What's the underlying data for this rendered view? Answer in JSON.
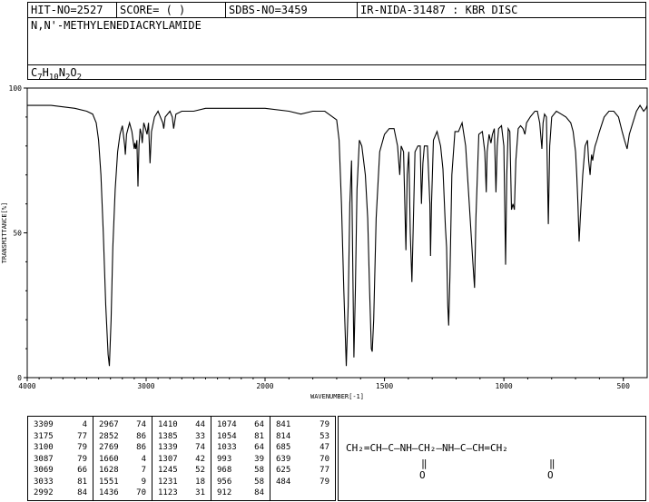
{
  "header": {
    "hit_no": "HIT-NO=2527",
    "score": "SCORE=  (   )",
    "sdbs_no": "SDBS-NO=3459",
    "ir_info": "IR-NIDA-31487 : KBR DISC",
    "compound_name": "N,N'-METHYLENEDIACRYLAMIDE",
    "formula": {
      "C": "7",
      "H": "10",
      "N": "2",
      "O": "2"
    }
  },
  "chart_data": {
    "type": "line",
    "xlabel": "WAVENUMBER[-1]",
    "ylabel": "TRANSMITTANCE[%]",
    "xlim": [
      4000,
      400
    ],
    "ylim": [
      0,
      100
    ],
    "x_ticks": [
      "4000",
      "3000",
      "2000",
      "1500",
      "1000",
      "500"
    ],
    "y_ticks": [
      "0",
      "50",
      "100"
    ],
    "grid": false,
    "series": [
      {
        "points": [
          [
            4000,
            94
          ],
          [
            3800,
            94
          ],
          [
            3600,
            93
          ],
          [
            3500,
            92
          ],
          [
            3450,
            91
          ],
          [
            3420,
            88
          ],
          [
            3400,
            82
          ],
          [
            3380,
            70
          ],
          [
            3360,
            50
          ],
          [
            3340,
            25
          ],
          [
            3320,
            8
          ],
          [
            3309,
            4
          ],
          [
            3295,
            20
          ],
          [
            3280,
            45
          ],
          [
            3260,
            65
          ],
          [
            3240,
            78
          ],
          [
            3220,
            84
          ],
          [
            3200,
            87
          ],
          [
            3180,
            80
          ],
          [
            3175,
            77
          ],
          [
            3165,
            84
          ],
          [
            3140,
            88
          ],
          [
            3120,
            85
          ],
          [
            3100,
            79
          ],
          [
            3095,
            81
          ],
          [
            3087,
            79
          ],
          [
            3078,
            82
          ],
          [
            3069,
            66
          ],
          [
            3060,
            80
          ],
          [
            3050,
            86
          ],
          [
            3040,
            84
          ],
          [
            3033,
            81
          ],
          [
            3020,
            88
          ],
          [
            3005,
            86
          ],
          [
            2992,
            84
          ],
          [
            2980,
            88
          ],
          [
            2967,
            74
          ],
          [
            2955,
            85
          ],
          [
            2930,
            90
          ],
          [
            2900,
            92
          ],
          [
            2880,
            90
          ],
          [
            2860,
            88
          ],
          [
            2852,
            86
          ],
          [
            2840,
            90
          ],
          [
            2800,
            92
          ],
          [
            2780,
            90
          ],
          [
            2769,
            86
          ],
          [
            2750,
            91
          ],
          [
            2700,
            92
          ],
          [
            2600,
            92
          ],
          [
            2500,
            93
          ],
          [
            2400,
            93
          ],
          [
            2300,
            93
          ],
          [
            2200,
            93
          ],
          [
            2100,
            93
          ],
          [
            2000,
            93
          ],
          [
            1900,
            92
          ],
          [
            1850,
            91
          ],
          [
            1800,
            92
          ],
          [
            1750,
            92
          ],
          [
            1700,
            89
          ],
          [
            1690,
            82
          ],
          [
            1680,
            60
          ],
          [
            1670,
            30
          ],
          [
            1660,
            4
          ],
          [
            1652,
            25
          ],
          [
            1645,
            60
          ],
          [
            1638,
            75
          ],
          [
            1633,
            40
          ],
          [
            1628,
            7
          ],
          [
            1622,
            30
          ],
          [
            1615,
            65
          ],
          [
            1605,
            82
          ],
          [
            1595,
            80
          ],
          [
            1580,
            70
          ],
          [
            1570,
            55
          ],
          [
            1562,
            30
          ],
          [
            1555,
            10
          ],
          [
            1551,
            9
          ],
          [
            1545,
            20
          ],
          [
            1535,
            55
          ],
          [
            1520,
            78
          ],
          [
            1500,
            84
          ],
          [
            1480,
            86
          ],
          [
            1460,
            86
          ],
          [
            1445,
            80
          ],
          [
            1436,
            70
          ],
          [
            1430,
            80
          ],
          [
            1420,
            78
          ],
          [
            1410,
            44
          ],
          [
            1405,
            70
          ],
          [
            1398,
            78
          ],
          [
            1392,
            50
          ],
          [
            1385,
            33
          ],
          [
            1380,
            50
          ],
          [
            1372,
            78
          ],
          [
            1360,
            80
          ],
          [
            1350,
            80
          ],
          [
            1345,
            60
          ],
          [
            1339,
            74
          ],
          [
            1333,
            80
          ],
          [
            1320,
            80
          ],
          [
            1310,
            60
          ],
          [
            1307,
            42
          ],
          [
            1303,
            60
          ],
          [
            1295,
            82
          ],
          [
            1280,
            85
          ],
          [
            1265,
            80
          ],
          [
            1255,
            72
          ],
          [
            1245,
            52
          ],
          [
            1240,
            45
          ],
          [
            1235,
            25
          ],
          [
            1231,
            18
          ],
          [
            1226,
            35
          ],
          [
            1218,
            70
          ],
          [
            1205,
            85
          ],
          [
            1190,
            85
          ],
          [
            1175,
            88
          ],
          [
            1160,
            80
          ],
          [
            1145,
            60
          ],
          [
            1130,
            40
          ],
          [
            1123,
            31
          ],
          [
            1117,
            55
          ],
          [
            1105,
            84
          ],
          [
            1090,
            85
          ],
          [
            1080,
            78
          ],
          [
            1074,
            64
          ],
          [
            1070,
            78
          ],
          [
            1062,
            84
          ],
          [
            1054,
            81
          ],
          [
            1048,
            84
          ],
          [
            1040,
            86
          ],
          [
            1033,
            64
          ],
          [
            1028,
            80
          ],
          [
            1022,
            86
          ],
          [
            1010,
            87
          ],
          [
            1000,
            80
          ],
          [
            993,
            39
          ],
          [
            988,
            70
          ],
          [
            982,
            86
          ],
          [
            975,
            85
          ],
          [
            968,
            58
          ],
          [
            962,
            60
          ],
          [
            956,
            58
          ],
          [
            950,
            75
          ],
          [
            940,
            86
          ],
          [
            930,
            87
          ],
          [
            920,
            86
          ],
          [
            912,
            84
          ],
          [
            905,
            88
          ],
          [
            890,
            90
          ],
          [
            870,
            92
          ],
          [
            860,
            92
          ],
          [
            850,
            88
          ],
          [
            841,
            79
          ],
          [
            836,
            88
          ],
          [
            830,
            91
          ],
          [
            822,
            90
          ],
          [
            814,
            53
          ],
          [
            808,
            80
          ],
          [
            800,
            90
          ],
          [
            780,
            92
          ],
          [
            760,
            91
          ],
          [
            740,
            90
          ],
          [
            720,
            88
          ],
          [
            710,
            85
          ],
          [
            700,
            78
          ],
          [
            695,
            70
          ],
          [
            690,
            60
          ],
          [
            685,
            47
          ],
          [
            680,
            55
          ],
          [
            670,
            70
          ],
          [
            660,
            80
          ],
          [
            650,
            82
          ],
          [
            645,
            75
          ],
          [
            639,
            70
          ],
          [
            633,
            77
          ],
          [
            628,
            75
          ],
          [
            625,
            77
          ],
          [
            618,
            80
          ],
          [
            610,
            82
          ],
          [
            600,
            85
          ],
          [
            580,
            90
          ],
          [
            560,
            92
          ],
          [
            540,
            92
          ],
          [
            520,
            90
          ],
          [
            505,
            85
          ],
          [
            495,
            82
          ],
          [
            484,
            79
          ],
          [
            475,
            84
          ],
          [
            460,
            88
          ],
          [
            445,
            92
          ],
          [
            430,
            94
          ],
          [
            415,
            92
          ],
          [
            405,
            93
          ],
          [
            400,
            94
          ]
        ]
      }
    ]
  },
  "peak_table": [
    [
      [
        "3309",
        "4"
      ],
      [
        "3175",
        "77"
      ],
      [
        "3100",
        "79"
      ],
      [
        "3087",
        "79"
      ],
      [
        "3069",
        "66"
      ],
      [
        "3033",
        "81"
      ],
      [
        "2992",
        "84"
      ]
    ],
    [
      [
        "2967",
        "74"
      ],
      [
        "2852",
        "86"
      ],
      [
        "2769",
        "86"
      ],
      [
        "1660",
        "4"
      ],
      [
        "1628",
        "7"
      ],
      [
        "1551",
        "9"
      ],
      [
        "1436",
        "70"
      ]
    ],
    [
      [
        "1410",
        "44"
      ],
      [
        "1385",
        "33"
      ],
      [
        "1339",
        "74"
      ],
      [
        "1307",
        "42"
      ],
      [
        "1245",
        "52"
      ],
      [
        "1231",
        "18"
      ],
      [
        "1123",
        "31"
      ]
    ],
    [
      [
        "1074",
        "64"
      ],
      [
        "1054",
        "81"
      ],
      [
        "1033",
        "64"
      ],
      [
        "993",
        "39"
      ],
      [
        "968",
        "58"
      ],
      [
        "956",
        "58"
      ],
      [
        "912",
        "84"
      ]
    ],
    [
      [
        "841",
        "79"
      ],
      [
        "814",
        "53"
      ],
      [
        "685",
        "47"
      ],
      [
        "639",
        "70"
      ],
      [
        "625",
        "77"
      ],
      [
        "484",
        "79"
      ]
    ]
  ],
  "structure": {
    "chain": "CH₂=CH—C—NH—CH₂—NH—C—CH=CH₂",
    "carbonyl_o": "O"
  }
}
